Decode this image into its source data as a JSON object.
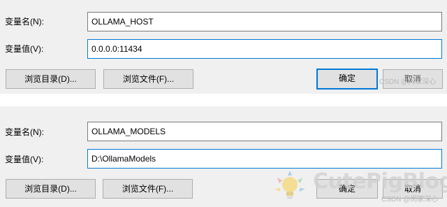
{
  "dialog1": {
    "name_label": "变量名(N):",
    "name_value": "OLLAMA_HOST",
    "value_label": "变量值(V):",
    "value_value": "0.0.0.0:11434",
    "browse_dir_label": "浏览目录(D)...",
    "browse_file_label": "浏览文件(F)...",
    "ok_label": "确定",
    "cancel_label": "取消",
    "watermark": "CSDN @闵家深心"
  },
  "dialog2": {
    "name_label": "变量名(N):",
    "name_value": "OLLAMA_MODELS",
    "value_label": "变量值(V):",
    "value_value": "D:\\OllamaModels",
    "browse_dir_label": "浏览目录(D)...",
    "browse_file_label": "浏览文件(F)...",
    "ok_label": "确定",
    "cancel_label": "取消",
    "watermark": "CSDN @闵家深心"
  },
  "logo_watermark": {
    "text": "CutePigBlog",
    "icon": "lightbulb-icon",
    "colors": {
      "yellow": "#f5d76e",
      "blue": "#8fc3e8",
      "pink": "#f2a1a1",
      "green": "#a5d6a7"
    }
  }
}
